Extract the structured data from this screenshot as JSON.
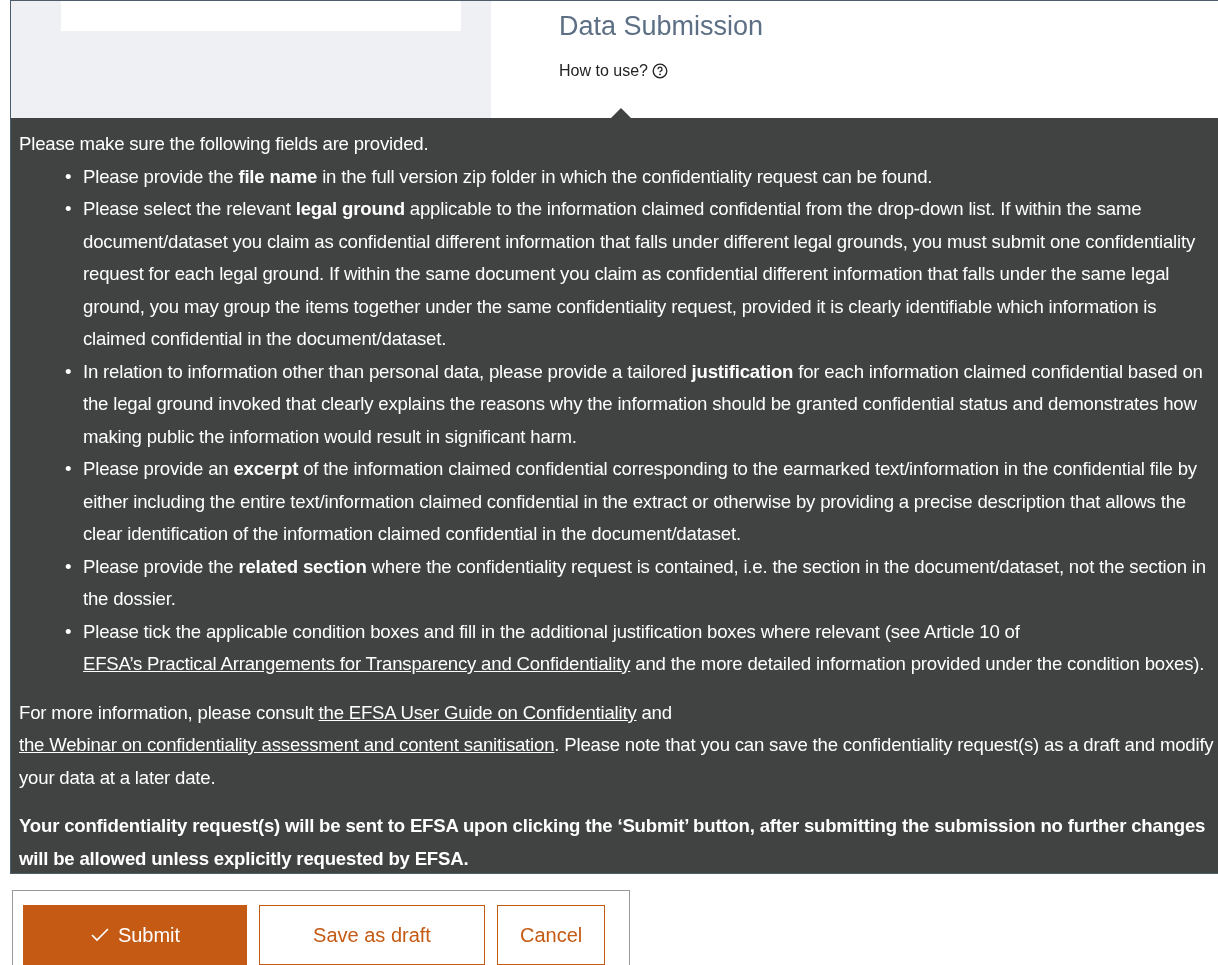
{
  "page": {
    "title": "Data Submission",
    "help_link": "How to use?"
  },
  "tooltip": {
    "intro": "Please make sure the following fields are provided.",
    "bullet": "•",
    "items": [
      [
        {
          "kind": "text",
          "text": "Please provide the **file name** in the full version zip folder in which the confidentiality request can be found."
        }
      ],
      [
        {
          "kind": "text",
          "text": "Please select the relevant **legal ground** applicable to the information claimed confidential from the drop-down list. If within the same document/dataset you claim as confidential different information that falls under different legal grounds, you must submit one confidentiality request for each legal ground. If within the same document you claim as confidential different information that falls under the same legal ground, you may group the items together under the same confidentiality request, provided it is clearly identifiable which information is claimed confidential in the document/dataset."
        }
      ],
      [
        {
          "kind": "text",
          "text": "In relation to information other than personal data, please provide a tailored **justification** for each information claimed confidential based on the legal ground invoked that clearly explains the reasons why the information should be granted confidential status and demonstrates how making public the information would result in significant harm."
        }
      ],
      [
        {
          "kind": "text",
          "text": "Please provide an **excerpt** of the information claimed confidential corresponding to the earmarked text/information in the confidential file by either including the entire text/information claimed confidential in the extract or otherwise by providing a precise description that allows the clear identification of the information claimed confidential in the document/dataset."
        }
      ],
      [
        {
          "kind": "text",
          "text": "Please provide the **related section** where the confidentiality request is contained, i.e. the section in the document/dataset, not the section in the dossier."
        }
      ],
      [
        {
          "kind": "text",
          "text": "Please tick the applicable condition boxes and fill in the additional justification boxes where relevant (see Article 10 of "
        },
        {
          "kind": "link",
          "text": "EFSA’s Practical Arrangements for Transparency and Confidentiality"
        },
        {
          "kind": "text",
          "text": " and the more detailed information provided under the condition boxes)."
        }
      ]
    ],
    "more_info": [
      {
        "kind": "text",
        "text": "For more information, please consult "
      },
      {
        "kind": "link",
        "text": "the EFSA User Guide on Confidentiality"
      },
      {
        "kind": "text",
        "text": " and "
      },
      {
        "kind": "link",
        "text": "the Webinar on confidentiality assessment and content sanitisation"
      },
      {
        "kind": "text",
        "text": ". Please note that you can save the confidentiality request(s) as a draft and modify your data at a later date."
      }
    ],
    "warning": "Your confidentiality request(s) will be sent to EFSA upon clicking the ‘Submit’ button, after submitting the submission no further changes will be allowed unless explicitly requested by EFSA."
  },
  "buttons": [
    {
      "label": "Submit",
      "kind": "primary"
    },
    {
      "label": "Save as draft",
      "kind": "secondary"
    },
    {
      "label": "Cancel",
      "kind": "secondary"
    }
  ]
}
